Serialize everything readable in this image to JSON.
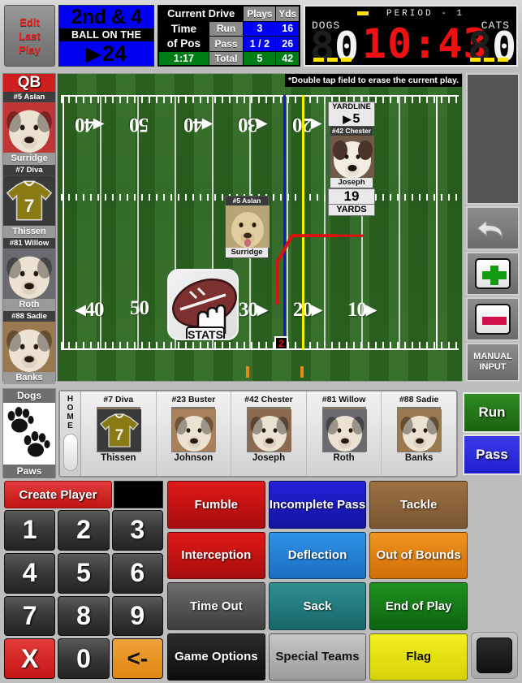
{
  "topbar": {
    "edit_last_play": [
      "Edit",
      "Last",
      "Play"
    ],
    "down_distance": "2nd & 4",
    "ball_on_label": "BALL ON THE",
    "ball_on_arrow": "▶",
    "ball_on_yard": "24"
  },
  "drive": {
    "title": "Current Drive",
    "col_plays": "Plays",
    "col_yds": "Yds",
    "time_of_pos_line1": "Time",
    "time_of_pos_line2": "of Pos",
    "row_run_label": "Run",
    "row_run_plays": "3",
    "row_run_yds": "16",
    "row_pass_label": "Pass",
    "row_pass_plays": "1 / 2",
    "row_pass_yds": "26",
    "time_value": "1:17",
    "row_total_label": "Total",
    "row_total_plays": "5",
    "row_total_yds": "42"
  },
  "scoreboard": {
    "period_label": "PERIOD  -  1",
    "home_team": "DOGS",
    "away_team": "CATS",
    "home_score": "0",
    "away_score": "0",
    "ghost_digit": "8",
    "clock": "10:43",
    "clock_color": "#ee1111",
    "indicator_color": "#ffe400"
  },
  "field": {
    "hint": "*Double tap field to erase the current play.",
    "numbers_top": [
      "40",
      "50",
      "40",
      "30",
      "20"
    ],
    "numbers_bottom": [
      "40",
      "50",
      "40",
      "30",
      "20",
      "10"
    ],
    "line_of_scrimmage_color": "#1414e6",
    "first_down_line_color": "#f2f200",
    "play_path_color": "#e01010",
    "down_marker": "2",
    "stats_logo_text": "STATS",
    "yardline_card": {
      "header": "YARDLINE",
      "arrow": "▶",
      "value": "5",
      "player_name": "#42 Chester",
      "player_last": "Joseph",
      "yards_value": "19",
      "yards_label": "YARDS"
    },
    "field_player": {
      "name": "#5 Aslan",
      "last": "Surridge"
    }
  },
  "left_sidebar": {
    "position_header": "QB",
    "players": [
      {
        "name": "#5 Aslan",
        "last": "Surridge",
        "type": "photo",
        "color": "#c03535"
      },
      {
        "name": "#7 Diva",
        "last": "Thissen",
        "type": "jersey",
        "jersey_number": "7",
        "color": "#8a7a14"
      },
      {
        "name": "#81 Willow",
        "last": "Roth",
        "type": "photo",
        "color": "#6a6a70"
      },
      {
        "name": "#88 Sadie",
        "last": "Banks",
        "type": "photo",
        "color": "#9a7850"
      }
    ]
  },
  "team_button": {
    "header": "Dogs",
    "footer": "Paws",
    "logo": "paw-prints"
  },
  "right_sidebar": {
    "undo_icon": "undo-arrow-icon",
    "plus_icon": "plus-icon",
    "minus_icon": "minus-icon",
    "manual_input_line1": "MANUAL",
    "manual_input_line2": "INPUT",
    "run_label": "Run",
    "pass_label": "Pass",
    "run_color": "#1b6210",
    "pass_color": "#1f1fcf"
  },
  "roster": {
    "tab_label": "HOME",
    "players": [
      {
        "name": "#7 Diva",
        "last": "Thissen",
        "type": "jersey",
        "jersey_number": "7",
        "color": "#8a7a14"
      },
      {
        "name": "#23 Buster",
        "last": "Johnson",
        "type": "photo",
        "color": "#a8805a"
      },
      {
        "name": "#42 Chester",
        "last": "Joseph",
        "type": "photo",
        "color": "#8b6a52"
      },
      {
        "name": "#81 Willow",
        "last": "Roth",
        "type": "photo",
        "color": "#6a6a70"
      },
      {
        "name": "#88 Sadie",
        "last": "Banks",
        "type": "photo",
        "color": "#9a7850"
      }
    ]
  },
  "keypad": {
    "create_player_label": "Create Player",
    "display_value": "",
    "keys": [
      {
        "label": "1",
        "style": "dark"
      },
      {
        "label": "2",
        "style": "dark"
      },
      {
        "label": "3",
        "style": "dark"
      },
      {
        "label": "4",
        "style": "dark"
      },
      {
        "label": "5",
        "style": "dark"
      },
      {
        "label": "6",
        "style": "dark"
      },
      {
        "label": "7",
        "style": "dark"
      },
      {
        "label": "8",
        "style": "dark"
      },
      {
        "label": "9",
        "style": "dark"
      },
      {
        "label": "X",
        "style": "red"
      },
      {
        "label": "0",
        "style": "dark"
      },
      {
        "label": "<-",
        "style": "orange"
      }
    ]
  },
  "actions": [
    {
      "label": "Fumble",
      "color": "#e01818",
      "color2": "#a80d0d"
    },
    {
      "label": "Incomplete Pass",
      "color": "#2222d8",
      "color2": "#1414a0"
    },
    {
      "label": "Tackle",
      "color": "#9c7244",
      "color2": "#7a5530"
    },
    {
      "label": "Interception",
      "color": "#e01818",
      "color2": "#a80d0d"
    },
    {
      "label": "Deflection",
      "color": "#2f92e8",
      "color2": "#1b6ec0"
    },
    {
      "label": "Out of Bounds",
      "color": "#ef941f",
      "color2": "#d06f08"
    },
    {
      "label": "Time Out",
      "color": "#6e6e6e",
      "color2": "#3c3c3c"
    },
    {
      "label": "Sack",
      "color": "#2f8f8f",
      "color2": "#18666a"
    },
    {
      "label": "End of Play",
      "color": "#1f9020",
      "color2": "#0d6410"
    },
    {
      "label": "Game Options",
      "color": "#2b2b2b",
      "color2": "#0d0d0d"
    },
    {
      "label": "Special Teams",
      "color": "#c6c6c6",
      "color2": "#9c9c9c"
    },
    {
      "label": "Flag",
      "color": "#f2ef1c",
      "color2": "#d6d20a"
    }
  ],
  "black_toggle": "black-square-button"
}
